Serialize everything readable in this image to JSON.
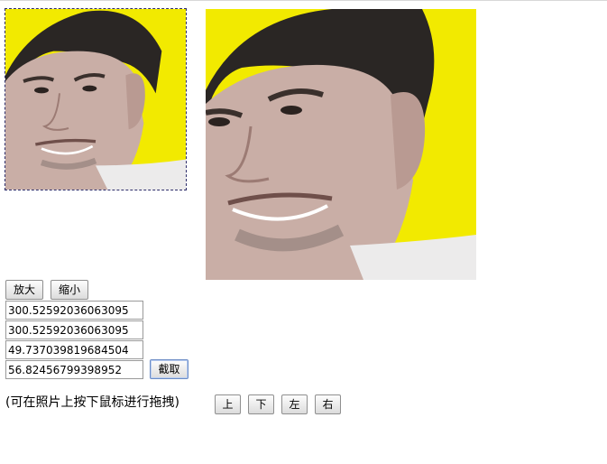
{
  "images": {
    "crop_area": {
      "description_icon": "portrait-photo"
    },
    "preview": {
      "description_icon": "portrait-photo"
    }
  },
  "zoom_controls": {
    "zoom_in_label": "放大",
    "zoom_out_label": "缩小"
  },
  "fields": {
    "width_value": "300.52592036063095",
    "height_value": "300.52592036063095",
    "left_value": "49.737039819684504",
    "top_value": "56.82456799398952"
  },
  "crop_button_label": "截取",
  "drag_hint": "(可在照片上按下鼠标进行拖拽)",
  "move_controls": {
    "up_label": "上",
    "down_label": "下",
    "left_label": "左",
    "right_label": "右"
  },
  "colors": {
    "background_yellow": "#f2ea00",
    "selection_border": "#2d2d6a"
  }
}
